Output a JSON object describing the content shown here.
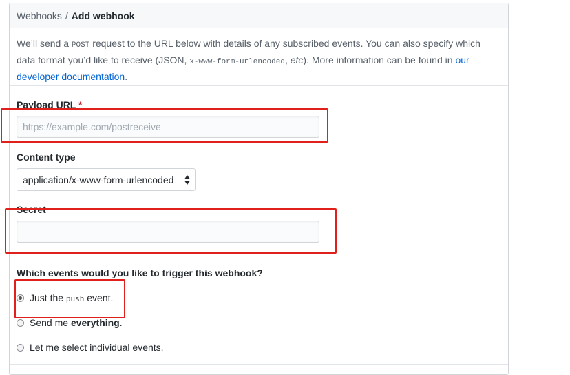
{
  "breadcrumb": {
    "parent": "Webhooks",
    "separator": "/",
    "current": "Add webhook"
  },
  "intro": {
    "part1": "We’ll send a ",
    "method": "POST",
    "part2": " request to the URL below with details of any subscribed events. You can also specify which data format you’d like to receive (JSON, ",
    "format": "x-www-form-urlencoded",
    "part3": ", ",
    "etc": "etc",
    "part4": "). More information can be found in ",
    "link_text": "our developer documentation",
    "part5": "."
  },
  "payload_url": {
    "label": "Payload URL",
    "required_mark": "*",
    "placeholder": "https://example.com/postreceive",
    "value": ""
  },
  "content_type": {
    "label": "Content type",
    "selected": "application/x-www-form-urlencoded"
  },
  "secret": {
    "label": "Secret",
    "value": ""
  },
  "events": {
    "question": "Which events would you like to trigger this webhook?",
    "options": [
      {
        "prefix": "Just the ",
        "code": "push",
        "suffix": " event.",
        "checked": true
      },
      {
        "prefix": "Send me ",
        "bold": "everything",
        "suffix": ".",
        "checked": false
      },
      {
        "prefix": "Let me select individual events.",
        "checked": false
      }
    ]
  },
  "annotation_color": "#e0201b"
}
